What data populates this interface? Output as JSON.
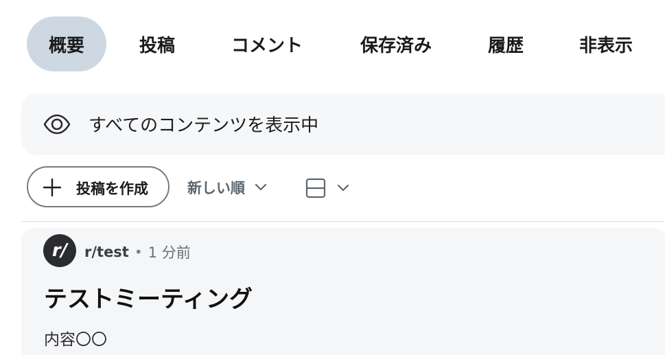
{
  "tabs": [
    {
      "label": "概要",
      "active": true
    },
    {
      "label": "投稿",
      "active": false
    },
    {
      "label": "コメント",
      "active": false
    },
    {
      "label": "保存済み",
      "active": false
    },
    {
      "label": "履歴",
      "active": false
    },
    {
      "label": "非表示",
      "active": false
    }
  ],
  "banner": {
    "icon": "eye-icon",
    "text": "すべてのコンテンツを表示中"
  },
  "toolbar": {
    "create_icon": "plus-icon",
    "create_label": "投稿を作成",
    "sort_label": "新しい順",
    "sort_icon": "chevron-down-icon",
    "view_icon": "card-layout-icon"
  },
  "post": {
    "avatar_text": "r/",
    "subreddit": "r/test",
    "separator": "•",
    "time": "1 分前",
    "title": "テストミーティング",
    "body": "内容〇〇"
  },
  "colors": {
    "active_tab_bg": "#cdd8e3",
    "banner_bg": "#f6f7f9",
    "post_bg": "#f5f6f8",
    "avatar_bg": "#2a2c30"
  }
}
